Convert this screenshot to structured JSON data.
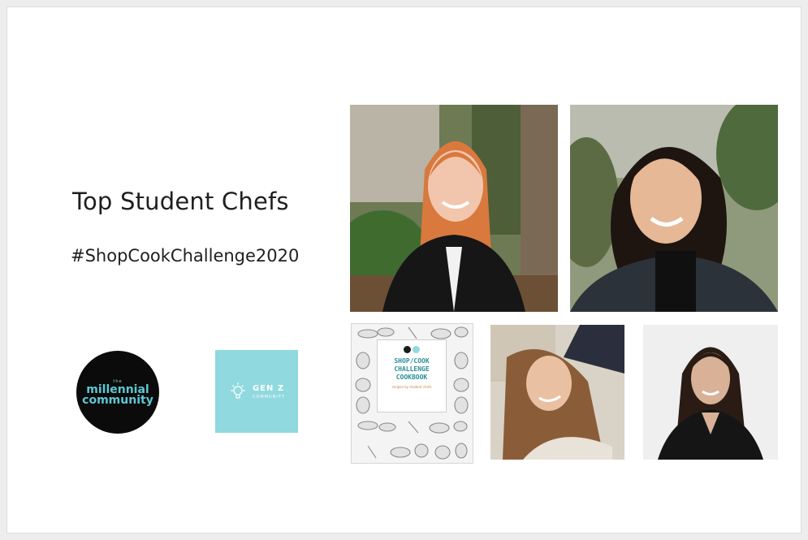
{
  "slide": {
    "title": "Top Student Chefs",
    "hashtag": "#ShopCookChallenge2020"
  },
  "logos": {
    "millennial": {
      "small": "the",
      "line1": "millennial",
      "line2": "community"
    },
    "genz": {
      "line1": "GEN Z",
      "line2": "COMMUNITY"
    }
  },
  "cookbook": {
    "title_lines": [
      "SHOP/COOK",
      "CHALLENGE",
      "COOKBOOK"
    ],
    "subtitle": "recipes by student chefs"
  },
  "colors": {
    "accent_teal": "#5cc8d3",
    "genz_bg": "#8fd9df",
    "book_title": "#2a8f98"
  },
  "icons": [
    "lightbulb-icon",
    "food-doodle-icon"
  ]
}
